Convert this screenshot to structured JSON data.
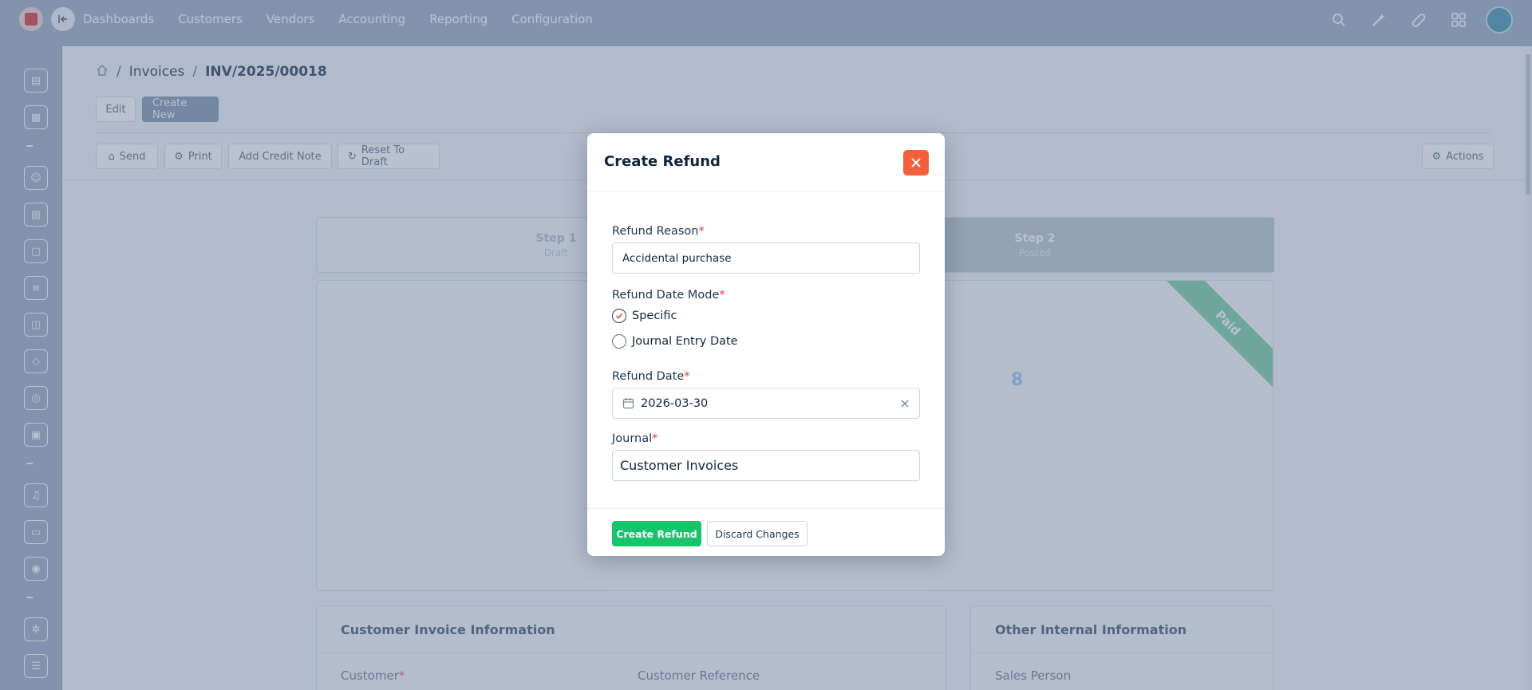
{
  "topbar": {
    "nav": [
      "Dashboards",
      "Customers",
      "Vendors",
      "Accounting",
      "Reporting",
      "Configuration"
    ],
    "icons": [
      "search-icon",
      "magic-wand-icon",
      "pill-icon",
      "grid-icon"
    ]
  },
  "breadcrumb": {
    "parent": "Invoices",
    "current": "INV/2025/00018"
  },
  "toolbar": {
    "edit": "Edit",
    "create_new": "Create New",
    "send": "Send",
    "print": "Print",
    "add_credit_note": "Add Credit Note",
    "reset_to_draft": "Reset To Draft",
    "actions": "Actions"
  },
  "steps": [
    {
      "title": "Step 1",
      "subtitle": "Draft"
    },
    {
      "title": "Step 2",
      "subtitle": "Posted"
    }
  ],
  "document": {
    "ribbon": "Paid",
    "visible_number": "8"
  },
  "info_cards": {
    "customer_invoice": {
      "title": "Customer Invoice Information",
      "customer_label": "Customer",
      "customer_reference_label": "Customer Reference"
    },
    "other_internal": {
      "title": "Other Internal Information",
      "sales_person_label": "Sales Person"
    }
  },
  "modal": {
    "title": "Create Refund",
    "refund_reason_label": "Refund Reason",
    "refund_reason_value": "Accidental purchase",
    "refund_date_mode_label": "Refund Date Mode",
    "date_mode_options": [
      "Specific",
      "Journal Entry Date"
    ],
    "date_mode_selected": "Specific",
    "refund_date_label": "Refund Date",
    "refund_date_value": "2026-03-30",
    "journal_label": "Journal",
    "journal_value": "Customer Invoices",
    "required_marker": "*",
    "create_button": "Create Refund",
    "discard_button": "Discard Changes"
  },
  "colors": {
    "create_button": "#17c46b",
    "close_button": "#f2603c",
    "ribbon": "#86d3ad",
    "overlay": "rgba(72, 92, 130, 0.38)"
  }
}
